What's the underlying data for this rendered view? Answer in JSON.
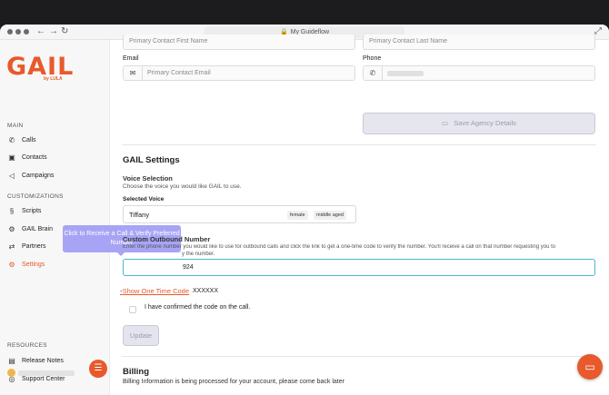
{
  "browser": {
    "url_title": "My Guideflow",
    "back_icon": "arrow-left",
    "forward_icon": "arrow-right",
    "reload_icon": "reload",
    "expand_icon": "expand"
  },
  "sidebar": {
    "logo": "GAIL",
    "logo_sub": "by LULA",
    "main_label": "MAIN",
    "customizations_label": "CUSTOMIZATIONS",
    "resources_label": "RESOURCES",
    "main_items": [
      {
        "label": "Calls",
        "icon": "phone"
      },
      {
        "label": "Contacts",
        "icon": "contact-card"
      },
      {
        "label": "Campaigns",
        "icon": "megaphone"
      }
    ],
    "custom_items": [
      {
        "label": "Scripts",
        "icon": "script"
      },
      {
        "label": "GAIL Brain",
        "icon": "brain"
      },
      {
        "label": "Partners",
        "icon": "handshake"
      },
      {
        "label": "Settings",
        "icon": "gear"
      }
    ],
    "resource_items": [
      {
        "label": "Release Notes",
        "icon": "notes"
      },
      {
        "label": "Support Center",
        "icon": "globe"
      }
    ]
  },
  "tooltip": {
    "text": "Click to Receive a Call & Verify Preferred Number"
  },
  "form": {
    "first_name_placeholder": "Primary Contact First Name",
    "last_name_placeholder": "Primary Contact Last Name",
    "email_label": "Email",
    "email_placeholder": "Primary Contact Email",
    "phone_label": "Phone",
    "save_button": "Save Agency Details"
  },
  "gail_settings": {
    "title": "GAIL Settings",
    "voice_selection_title": "Voice Selection",
    "voice_selection_desc": "Choose the voice you would like GAIL to use.",
    "selected_voice_label": "Selected Voice",
    "selected_voice": "Tiffany",
    "voice_tags": [
      "female",
      "middle aged"
    ],
    "outbound_title": "Custom Outbound Number",
    "outbound_desc_1": "Enter the phone number you would like to use for outbound calls and click the link to get a one-time code to verify the number. You'll receive a call on that number requesting you to",
    "outbound_desc_2": "y the number.",
    "phone_value": "924",
    "show_code_link": "Show One Time Code",
    "code_value": "XXXXXX",
    "confirm_label": "I have confirmed the code on the call.",
    "update_button": "Update"
  },
  "billing": {
    "title": "Billing",
    "desc": "Billing Information is being processed for your account, please come back later"
  },
  "colors": {
    "brand": "#e8592b",
    "tooltip": "#a8a4f5",
    "focus": "#49b8c9"
  }
}
